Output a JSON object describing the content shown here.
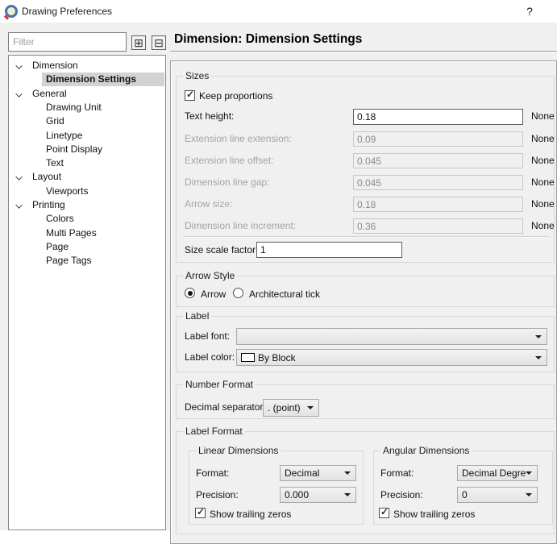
{
  "window": {
    "title": "Drawing Preferences",
    "help_label": "?"
  },
  "colors": {
    "dialog_bg": "#f0f0f0",
    "selection_bg": "#d2d2d2",
    "swatch_by_block": "#ffffff"
  },
  "icons": {
    "expand_all": "⊞",
    "collapse_all": "⊟",
    "check": "✓"
  },
  "filter": {
    "placeholder": "Filter"
  },
  "heading": "Dimension: Dimension Settings",
  "tree": {
    "items": [
      {
        "label": "Dimension"
      },
      {
        "label": "Dimension Settings"
      },
      {
        "label": "General"
      },
      {
        "label": "Drawing Unit"
      },
      {
        "label": "Grid"
      },
      {
        "label": "Linetype"
      },
      {
        "label": "Point Display"
      },
      {
        "label": "Text"
      },
      {
        "label": "Layout"
      },
      {
        "label": "Viewports"
      },
      {
        "label": "Printing"
      },
      {
        "label": "Colors"
      },
      {
        "label": "Multi Pages"
      },
      {
        "label": "Page"
      },
      {
        "label": "Page Tags"
      }
    ]
  },
  "sizes": {
    "group_label": "Sizes",
    "keep_proportions": {
      "label": "Keep proportions",
      "checked": true
    },
    "rows": [
      {
        "label": "Text height:",
        "value": "0.18",
        "suffix": "None",
        "enabled": true
      },
      {
        "label": "Extension line extension:",
        "value": "0.09",
        "suffix": "None",
        "enabled": false
      },
      {
        "label": "Extension line offset:",
        "value": "0.045",
        "suffix": "None",
        "enabled": false
      },
      {
        "label": "Dimension line gap:",
        "value": "0.045",
        "suffix": "None",
        "enabled": false
      },
      {
        "label": "Arrow size:",
        "value": "0.18",
        "suffix": "None",
        "enabled": false
      },
      {
        "label": "Dimension line increment:",
        "value": "0.36",
        "suffix": "None",
        "enabled": false
      }
    ],
    "size_scale": {
      "label": "Size scale factor:",
      "value": "1"
    }
  },
  "arrow_style": {
    "group_label": "Arrow Style",
    "options": [
      {
        "label": "Arrow",
        "selected": true
      },
      {
        "label": "Architectural tick",
        "selected": false
      }
    ]
  },
  "label_group": {
    "group_label": "Label",
    "font_label": "Label font:",
    "font_value": "",
    "color_label": "Label color:",
    "color_value": "By Block"
  },
  "number_format": {
    "group_label": "Number Format",
    "separator_label": "Decimal separator:",
    "separator_value": ". (point)"
  },
  "label_format": {
    "group_label": "Label Format",
    "linear": {
      "group_label": "Linear Dimensions",
      "format_label": "Format:",
      "format_value": "Decimal",
      "precision_label": "Precision:",
      "precision_value": "0.000",
      "trailing_label": "Show trailing zeros",
      "trailing_checked": true
    },
    "angular": {
      "group_label": "Angular Dimensions",
      "format_label": "Format:",
      "format_value": "Decimal Degrees",
      "precision_label": "Precision:",
      "precision_value": "0",
      "trailing_label": "Show trailing zeros",
      "trailing_checked": true
    }
  }
}
